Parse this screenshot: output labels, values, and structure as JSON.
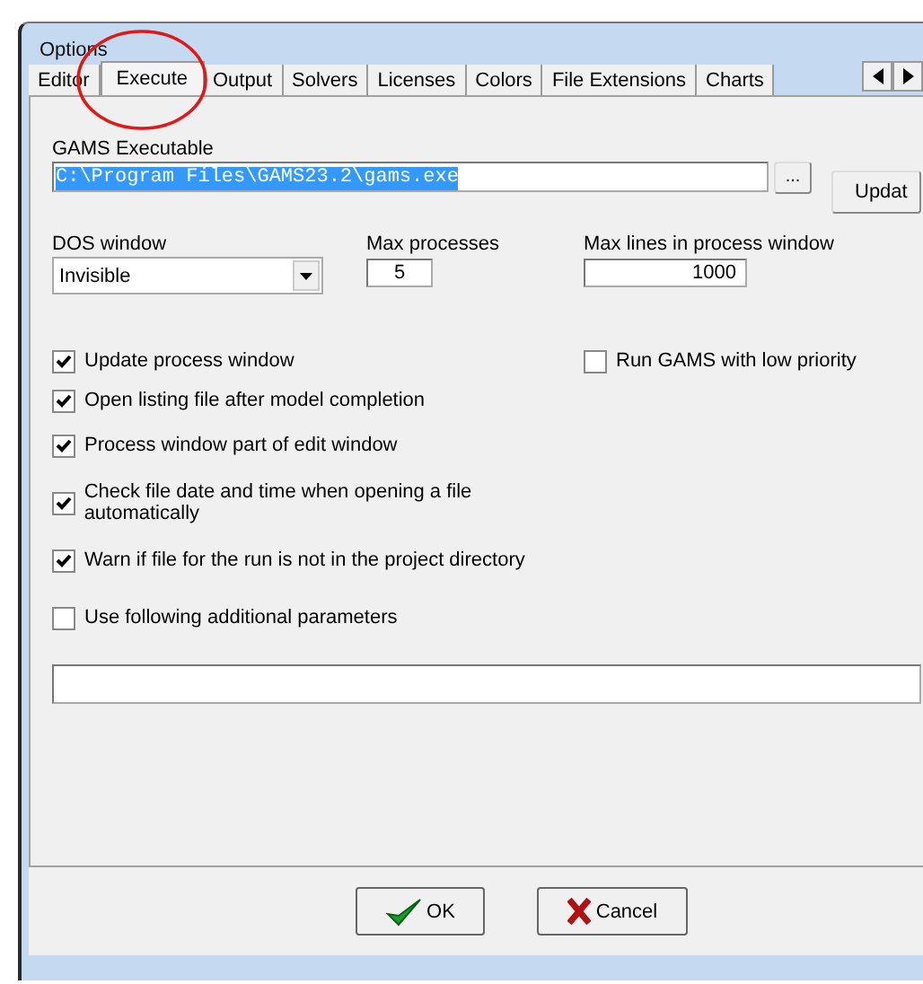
{
  "window": {
    "title": "Options"
  },
  "tabs": [
    {
      "label": "Editor",
      "selected": false,
      "circled": false
    },
    {
      "label": "Execute",
      "selected": true,
      "circled": true
    },
    {
      "label": "Output",
      "selected": false,
      "circled": false
    },
    {
      "label": "Solvers",
      "selected": false,
      "circled": false
    },
    {
      "label": "Licenses",
      "selected": false,
      "circled": false
    },
    {
      "label": "Colors",
      "selected": false,
      "circled": false
    },
    {
      "label": "File Extensions",
      "selected": false,
      "circled": false
    },
    {
      "label": "Charts",
      "selected": false,
      "circled": false
    }
  ],
  "executable": {
    "label": "GAMS Executable",
    "value": "C:\\Program Files\\GAMS23.2\\gams.exe",
    "value_selected": true,
    "browse_button": "...",
    "update_button": "Updat"
  },
  "dos_window": {
    "label": "DOS window",
    "value": "Invisible"
  },
  "max_processes": {
    "label": "Max processes",
    "value": "5"
  },
  "max_lines": {
    "label": "Max lines in process window",
    "value": "1000"
  },
  "option_rows": [
    {
      "items": [
        {
          "label": "Update process window",
          "checked": true
        },
        {
          "label": "Run GAMS with low priority",
          "checked": false
        }
      ]
    },
    {
      "items": [
        {
          "label": "Open listing file after model completion",
          "checked": true
        }
      ]
    },
    {
      "items": [
        {
          "label": "Process window part of edit window",
          "checked": true
        }
      ]
    },
    {
      "items": [
        {
          "label": "Check file date and time when opening a file automatically",
          "checked": true
        }
      ]
    },
    {
      "items": [
        {
          "label": "Warn if file for the run is not in the project directory",
          "checked": true
        }
      ]
    },
    {
      "items": [
        {
          "label": "Use following additional parameters",
          "checked": false
        }
      ]
    }
  ],
  "buttons": [
    {
      "label": "OK",
      "kind": "ok"
    },
    {
      "label": "Cancel",
      "kind": "cancel"
    }
  ]
}
